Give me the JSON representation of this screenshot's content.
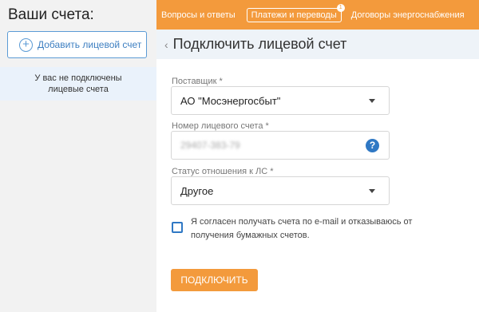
{
  "sidebar": {
    "title": "Ваши счета:",
    "add_account_label": "Добавить лицевой счет",
    "empty_message": "У вас не подключены лицевые счета"
  },
  "nav": {
    "items": [
      {
        "label": "Вопросы и ответы"
      },
      {
        "label": "Платежи и переводы",
        "badge": "1"
      },
      {
        "label": "Договоры энергоснабжения"
      }
    ]
  },
  "page": {
    "title": "Подключить лицевой счет"
  },
  "form": {
    "provider_label": "Поставщик *",
    "provider_value": "АО \"Мосэнергосбыт\"",
    "account_label": "Номер лицевого счета *",
    "account_value": "29407-383-79",
    "status_label": "Статус отношения к ЛС *",
    "status_value": "Другое",
    "consent_text": "Я согласен получать счета по e-mail и отказываюсь от получения бумажных счетов.",
    "consent_checked": false,
    "submit_label": "ПОДКЛЮЧИТЬ"
  },
  "colors": {
    "accent": "#f39a3c",
    "link": "#2f78c4",
    "sidebar_bg": "#f2f2f2"
  }
}
